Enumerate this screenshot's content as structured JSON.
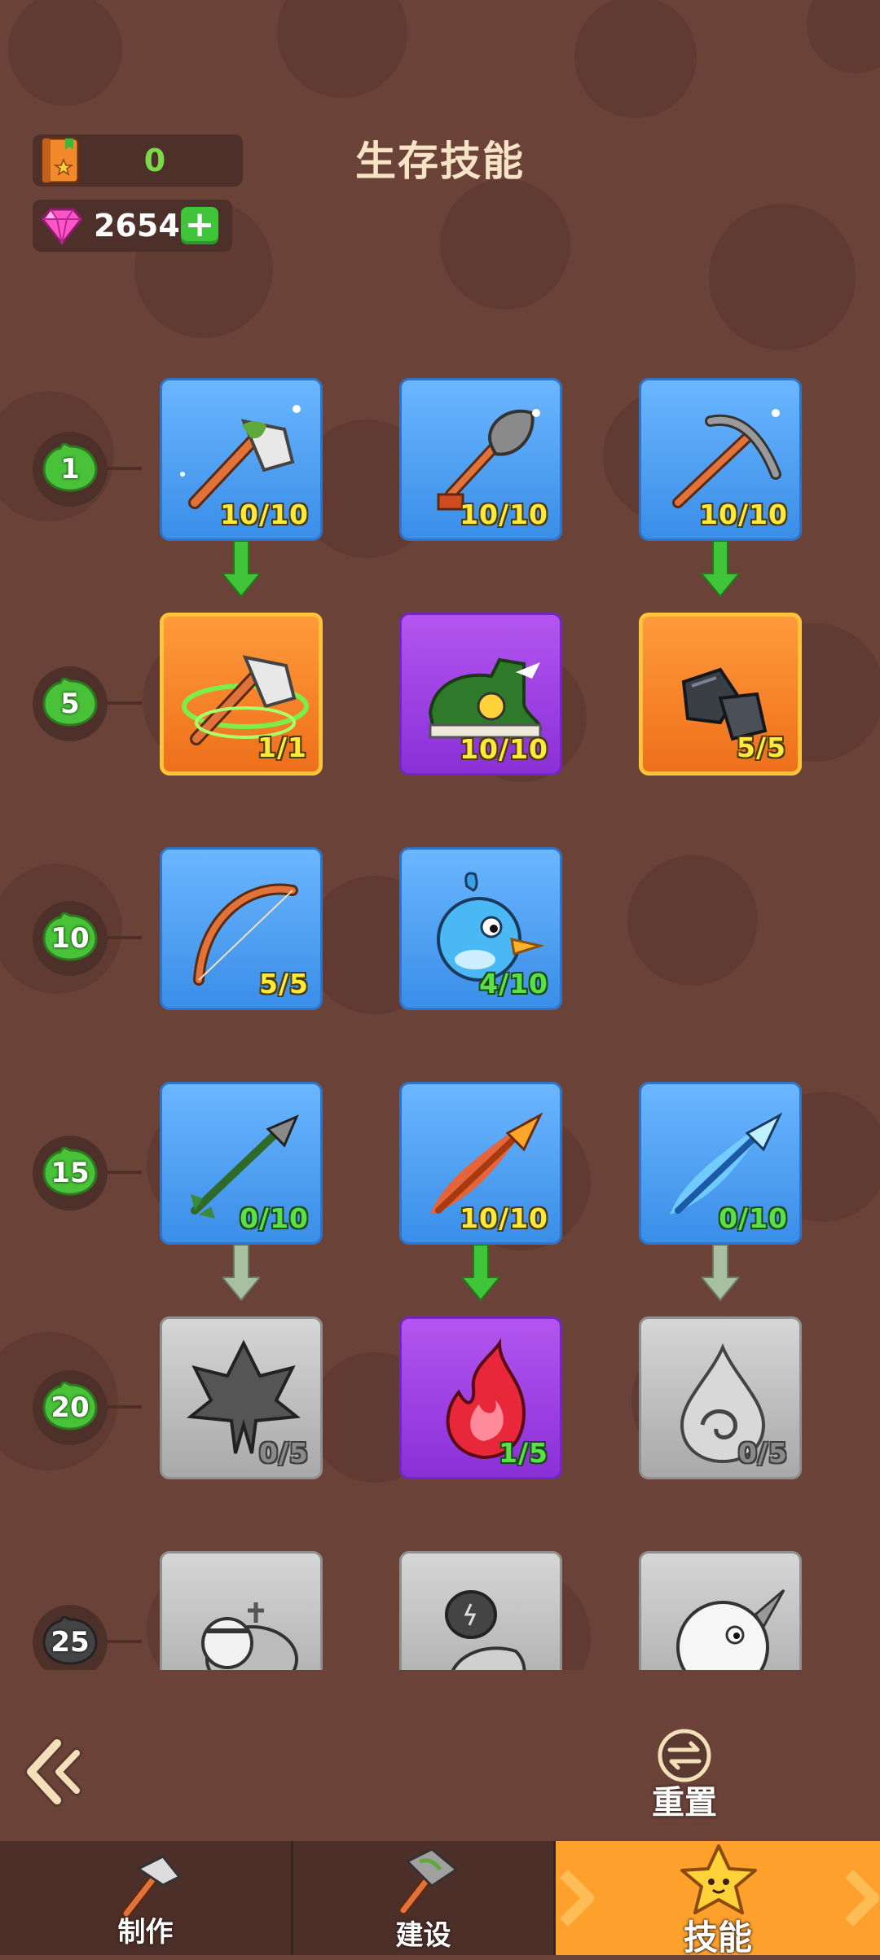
{
  "header": {
    "title": "生存技能",
    "book_count": "0",
    "gems": "2654"
  },
  "levels": [
    "1",
    "5",
    "10",
    "15",
    "20",
    "25"
  ],
  "skills": {
    "r1": [
      {
        "icon": "axe-icon",
        "count": "10/10",
        "tier": "blue"
      },
      {
        "icon": "shovel-icon",
        "count": "10/10",
        "tier": "blue"
      },
      {
        "icon": "pickaxe-icon",
        "count": "10/10",
        "tier": "blue"
      }
    ],
    "r5": [
      {
        "icon": "spinning-axe-icon",
        "count": "1/1",
        "tier": "orange"
      },
      {
        "icon": "speed-shoe-icon",
        "count": "10/10",
        "tier": "purple"
      },
      {
        "icon": "ore-icon",
        "count": "5/5",
        "tier": "orange"
      }
    ],
    "r10": [
      {
        "icon": "bow-icon",
        "count": "5/5",
        "tier": "blue"
      },
      {
        "icon": "blue-bird-icon",
        "count": "4/10",
        "tier": "blue"
      }
    ],
    "r15": [
      {
        "icon": "arrow-icon",
        "count": "0/10",
        "tier": "blue"
      },
      {
        "icon": "fire-arrow-icon",
        "count": "10/10",
        "tier": "blue"
      },
      {
        "icon": "ice-arrow-icon",
        "count": "0/10",
        "tier": "blue"
      }
    ],
    "r20": [
      {
        "icon": "leaf-icon",
        "count": "0/5",
        "tier": "gray"
      },
      {
        "icon": "flame-icon",
        "count": "1/5",
        "tier": "purple"
      },
      {
        "icon": "water-drop-icon",
        "count": "0/5",
        "tier": "gray"
      }
    ],
    "r25": [
      {
        "icon": "turtle-icon",
        "tier": "gray"
      },
      {
        "icon": "power-arm-icon",
        "tier": "gray"
      },
      {
        "icon": "narwhal-icon",
        "tier": "gray"
      }
    ]
  },
  "controls": {
    "reset_label": "重置"
  },
  "nav": {
    "craft": "制作",
    "build": "建设",
    "skills": "技能",
    "active": "skills"
  },
  "colors": {
    "background": "#6b4238",
    "tier_blue": "#4a9ef2",
    "tier_orange": "#f57f24",
    "tier_purple": "#9d3fe3",
    "tier_gray": "#b8b8b8",
    "nav_active": "#fda12c",
    "level_leaf": "#49c23a"
  }
}
